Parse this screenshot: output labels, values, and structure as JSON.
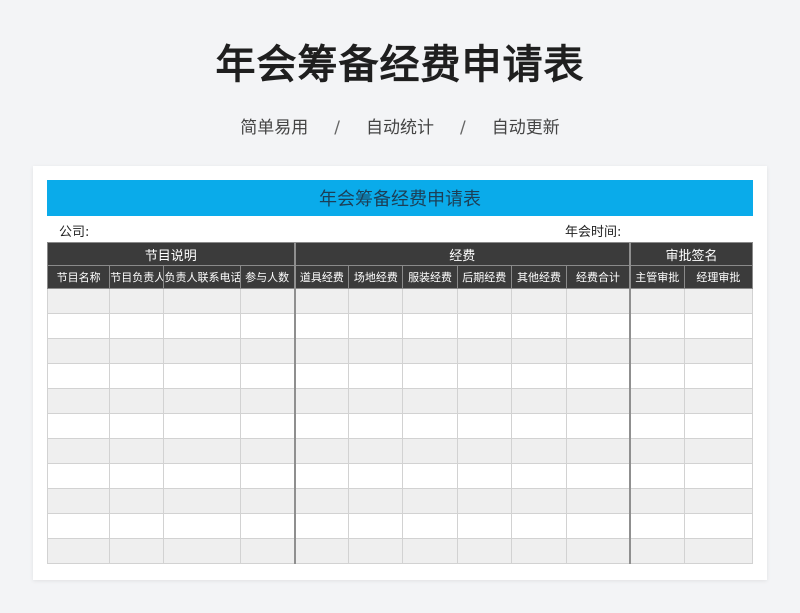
{
  "header": {
    "title": "年会筹备经费申请表",
    "features": [
      "简单易用",
      "自动统计",
      "自动更新"
    ],
    "separator": "/"
  },
  "sheet": {
    "title": "年会筹备经费申请表",
    "company_label": "公司:",
    "time_label": "年会时间:",
    "groups": [
      "节目说明",
      "经费",
      "审批签名"
    ],
    "columns": [
      "节目名称",
      "节目负责人",
      "负责人联系电话",
      "参与人数",
      "道具经费",
      "场地经费",
      "服装经费",
      "后期经费",
      "其他经费",
      "经费合计",
      "主管审批",
      "经理审批"
    ],
    "empty_rows": 11
  },
  "colors": {
    "banner": "#0aabea",
    "header_dark": "#3b3b3b",
    "row_stripe": "#efefef"
  }
}
